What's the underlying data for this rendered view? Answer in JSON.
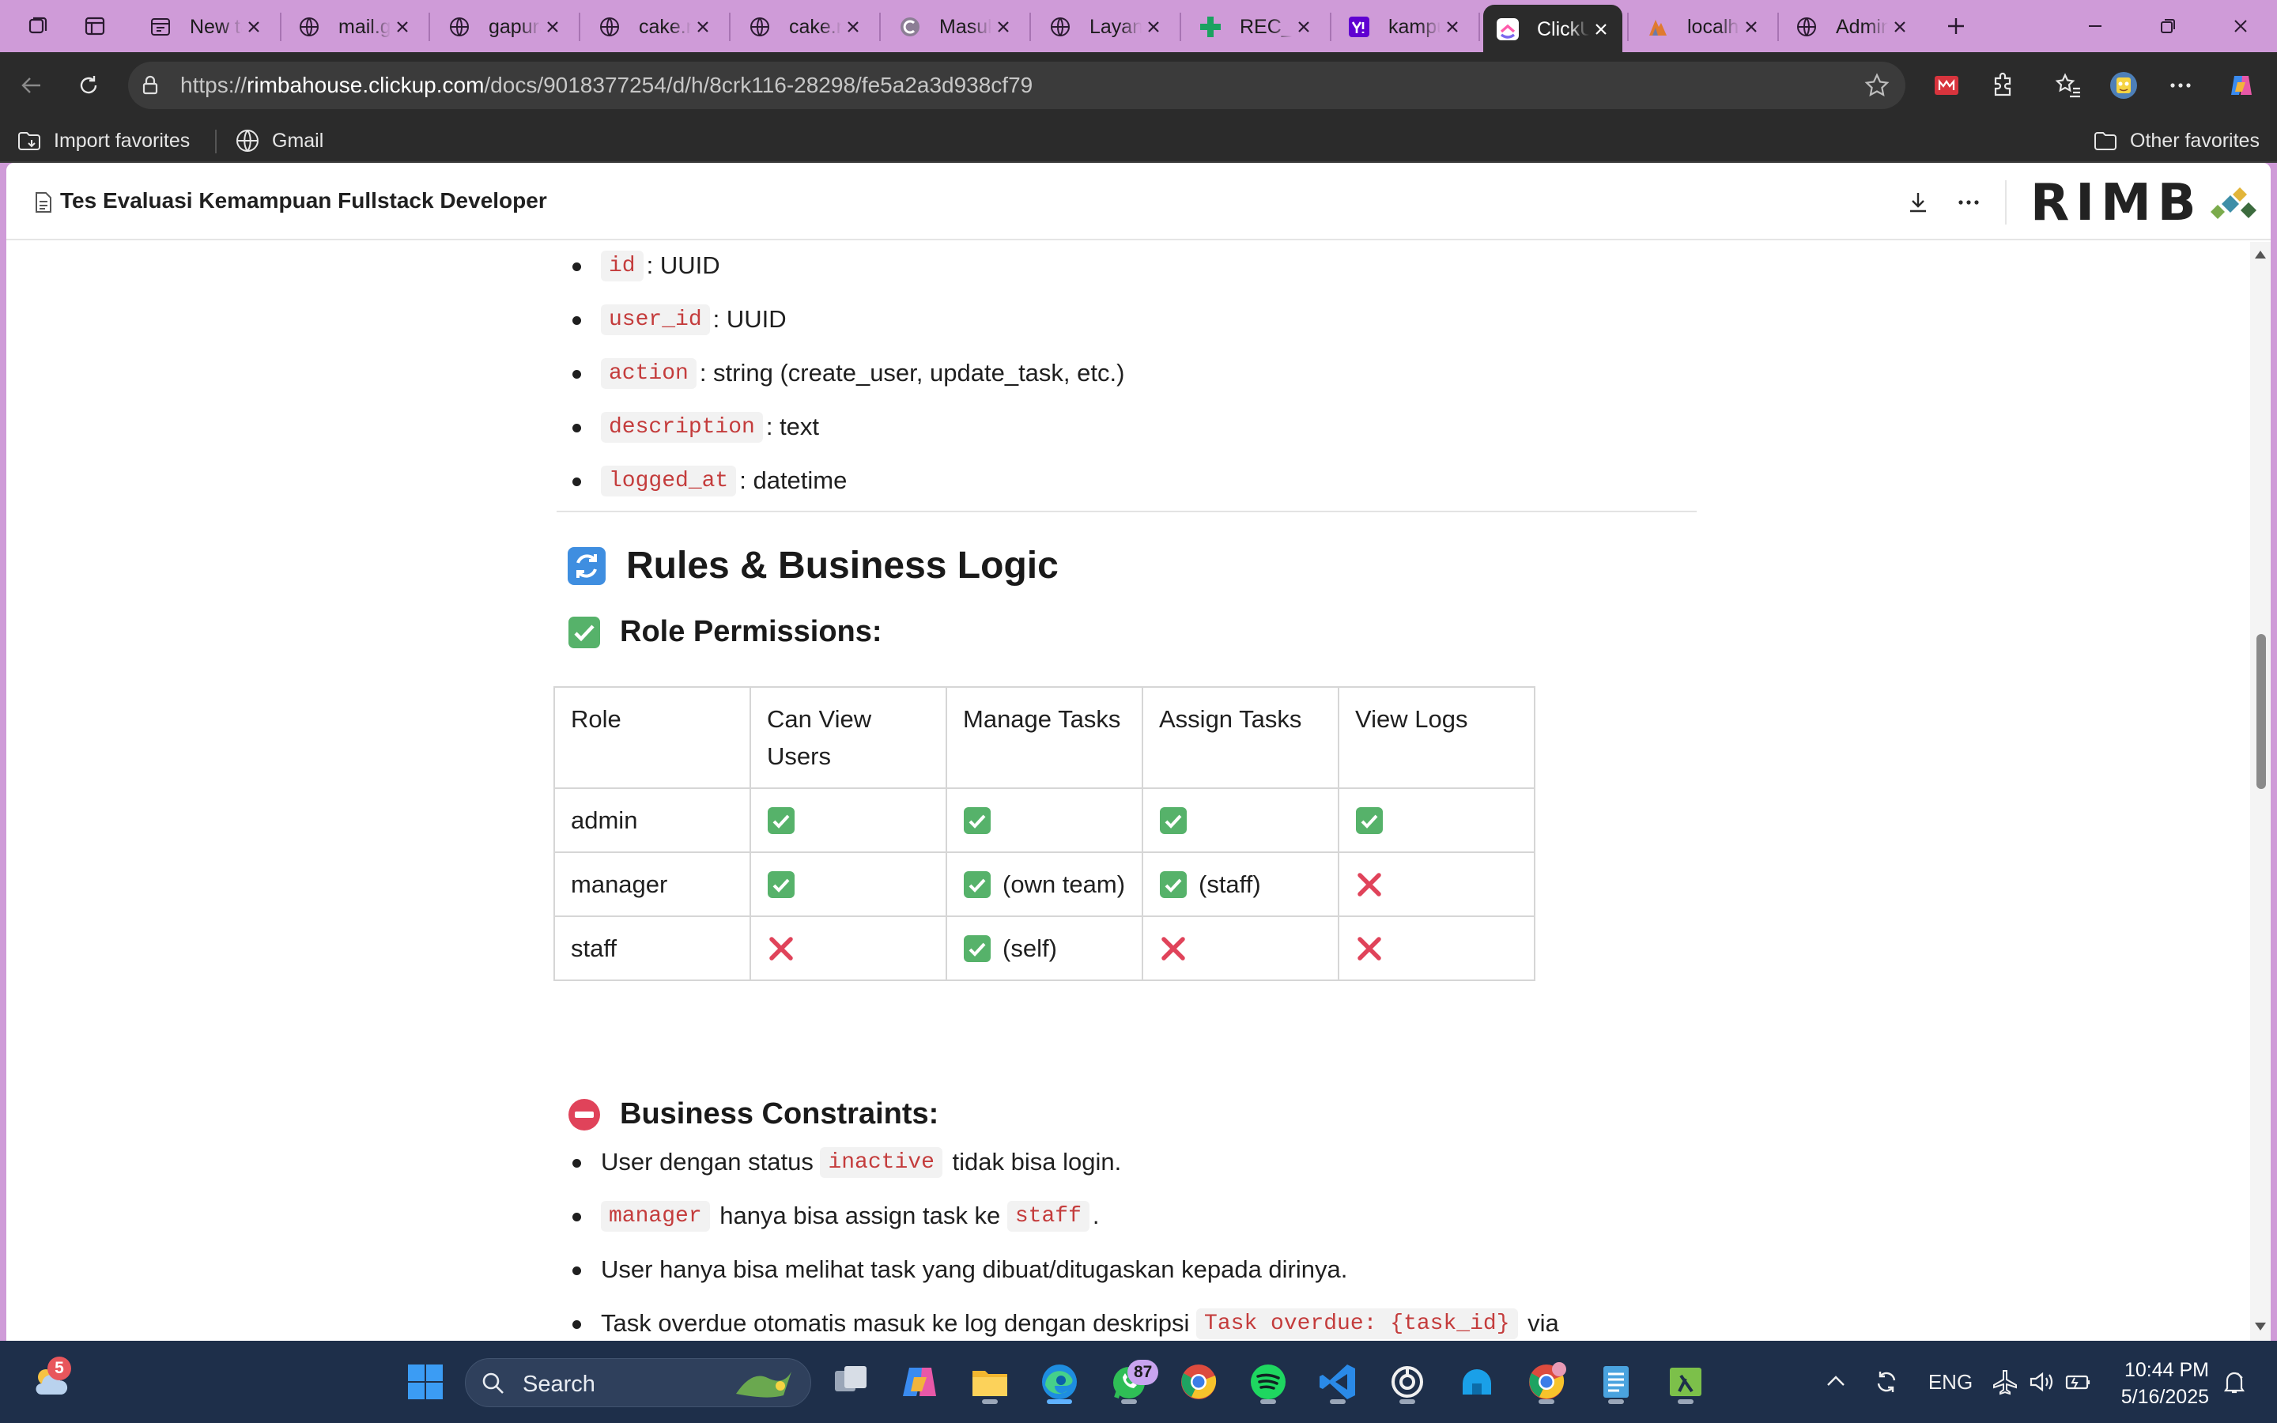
{
  "browser": {
    "tabs": [
      {
        "label": "New tab",
        "icon": "new-tab-icon"
      },
      {
        "label": "mail.gapura",
        "icon": "globe-icon"
      },
      {
        "label": "gapura",
        "icon": "globe-icon"
      },
      {
        "label": "cake.n",
        "icon": "globe-icon"
      },
      {
        "label": "cake.n",
        "icon": "globe-icon"
      },
      {
        "label": "Masuk",
        "icon": "c-icon"
      },
      {
        "label": "Layanan",
        "icon": "globe-icon"
      },
      {
        "label": "REC_R",
        "icon": "plus-green-icon"
      },
      {
        "label": "kampus",
        "icon": "yahoo-icon"
      },
      {
        "label": "ClickUp",
        "icon": "clickup-icon"
      },
      {
        "label": "localhost",
        "icon": "pma-icon"
      },
      {
        "label": "Admin",
        "icon": "globe-icon"
      }
    ],
    "active_tab_index": 9,
    "url_host": "rimbahouse.clickup.com",
    "url_prefix": "https://",
    "url_path": "/docs/9018377254/d/h/8crk116-28298/fe5a2a3d938cf79",
    "favorites": {
      "import_label": "Import favorites",
      "gmail_label": "Gmail",
      "other_label": "Other favorites"
    }
  },
  "doc": {
    "title": "Tes Evaluasi Kemampuan Fullstack Developer",
    "logo_text": "RIMB",
    "fields": [
      {
        "code": "id",
        "desc": ": UUID"
      },
      {
        "code": "user_id",
        "desc": ": UUID"
      },
      {
        "code": "action",
        "desc": ": string (create_user, update_task, etc.)"
      },
      {
        "code": "description",
        "desc": ": text"
      },
      {
        "code": "logged_at",
        "desc": ": datetime"
      }
    ],
    "section_title": "Rules & Business Logic",
    "permissions_title": "Role Permissions:",
    "table": {
      "headers": [
        "Role",
        "Can View Users",
        "Manage Tasks",
        "Assign Tasks",
        "View Logs"
      ],
      "rows": [
        {
          "role": "admin",
          "cells": [
            {
              "ok": true,
              "note": ""
            },
            {
              "ok": true,
              "note": ""
            },
            {
              "ok": true,
              "note": ""
            },
            {
              "ok": true,
              "note": ""
            }
          ]
        },
        {
          "role": "manager",
          "cells": [
            {
              "ok": true,
              "note": ""
            },
            {
              "ok": true,
              "note": "(own team)"
            },
            {
              "ok": true,
              "note": "(staff)"
            },
            {
              "ok": false,
              "note": ""
            }
          ]
        },
        {
          "role": "staff",
          "cells": [
            {
              "ok": false,
              "note": ""
            },
            {
              "ok": true,
              "note": "(self)"
            },
            {
              "ok": false,
              "note": ""
            },
            {
              "ok": false,
              "note": ""
            }
          ]
        }
      ]
    },
    "constraints_title": "Business Constraints:",
    "constraints": {
      "c1_pre": "User dengan status",
      "c1_code": "inactive",
      "c1_post": "tidak bisa login.",
      "c2_code1": "manager",
      "c2_mid": "hanya bisa assign task ke",
      "c2_code2": "staff",
      "c2_post": ".",
      "c3": "User hanya bisa melihat task yang dibuat/ditugaskan kepada dirinya.",
      "c4_pre": "Task overdue otomatis masuk ke log dengan deskripsi",
      "c4_code": "Task overdue: {task_id}",
      "c4_post": "via"
    }
  },
  "taskbar": {
    "search_label": "Search",
    "weather_badge": "5",
    "whatsapp_badge": "87",
    "lang": "ENG",
    "time": "10:44 PM",
    "date": "5/16/2025"
  },
  "colors": {
    "tabstrip": "#cf9bd8",
    "chrome_dark": "#2b2b2b",
    "code_text": "#c43c3c",
    "check_green": "#56b26a",
    "cross_red": "#e0435a",
    "taskbar": "#1e2f4a"
  }
}
